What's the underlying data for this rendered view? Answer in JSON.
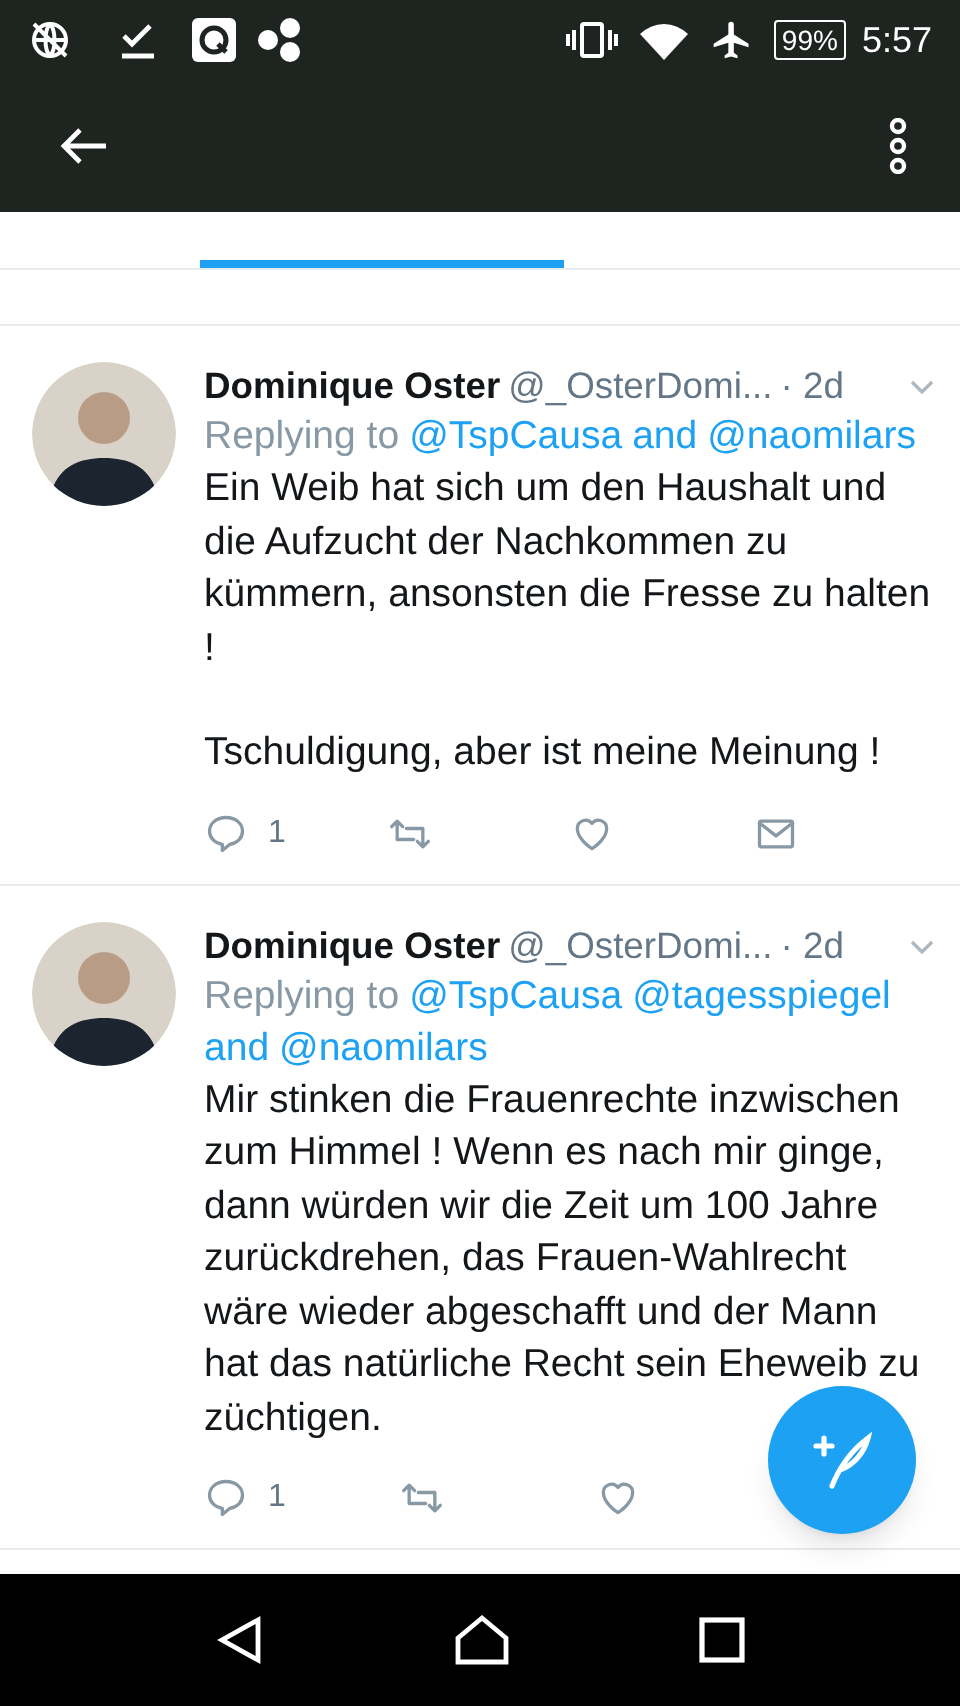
{
  "status_bar": {
    "battery": "99%",
    "time": "5:57"
  },
  "tweets": [
    {
      "name": "Dominique Oster",
      "handle": "@_OsterDomi...",
      "time": "· 2d",
      "replying_prefix": "Replying to",
      "mentions": [
        "@TspCausa",
        "and",
        "@naomilars"
      ],
      "paragraphs": [
        "Ein Weib hat sich um den Haushalt und die Aufzucht der Nachkommen zu kümmern, ansonsten die Fresse zu halten !",
        "Tschuldigung, aber ist meine Meinung !"
      ],
      "actions": [
        {
          "kind": "reply",
          "count": "1"
        },
        {
          "kind": "retweet"
        },
        {
          "kind": "like"
        },
        {
          "kind": "message"
        }
      ]
    },
    {
      "name": "Dominique Oster",
      "handle": "@_OsterDomi...",
      "time": "· 2d",
      "replying_prefix": "Replying to",
      "mentions": [
        "@TspCausa",
        "@tagesspiegel",
        "and",
        "@naomilars"
      ],
      "paragraphs": [
        "Mir stinken die Frauenrechte inzwischen zum Himmel ! Wenn es nach mir ginge, dann würden wir die Zeit um 100 Jahre zurückdrehen, das Frauen-Wahlrecht wäre wieder abgeschafft und der Mann hat das natürliche Recht sein Eheweib zu züchtigen."
      ],
      "actions": [
        {
          "kind": "reply",
          "count": "1"
        },
        {
          "kind": "retweet"
        },
        {
          "kind": "like"
        }
      ]
    }
  ]
}
